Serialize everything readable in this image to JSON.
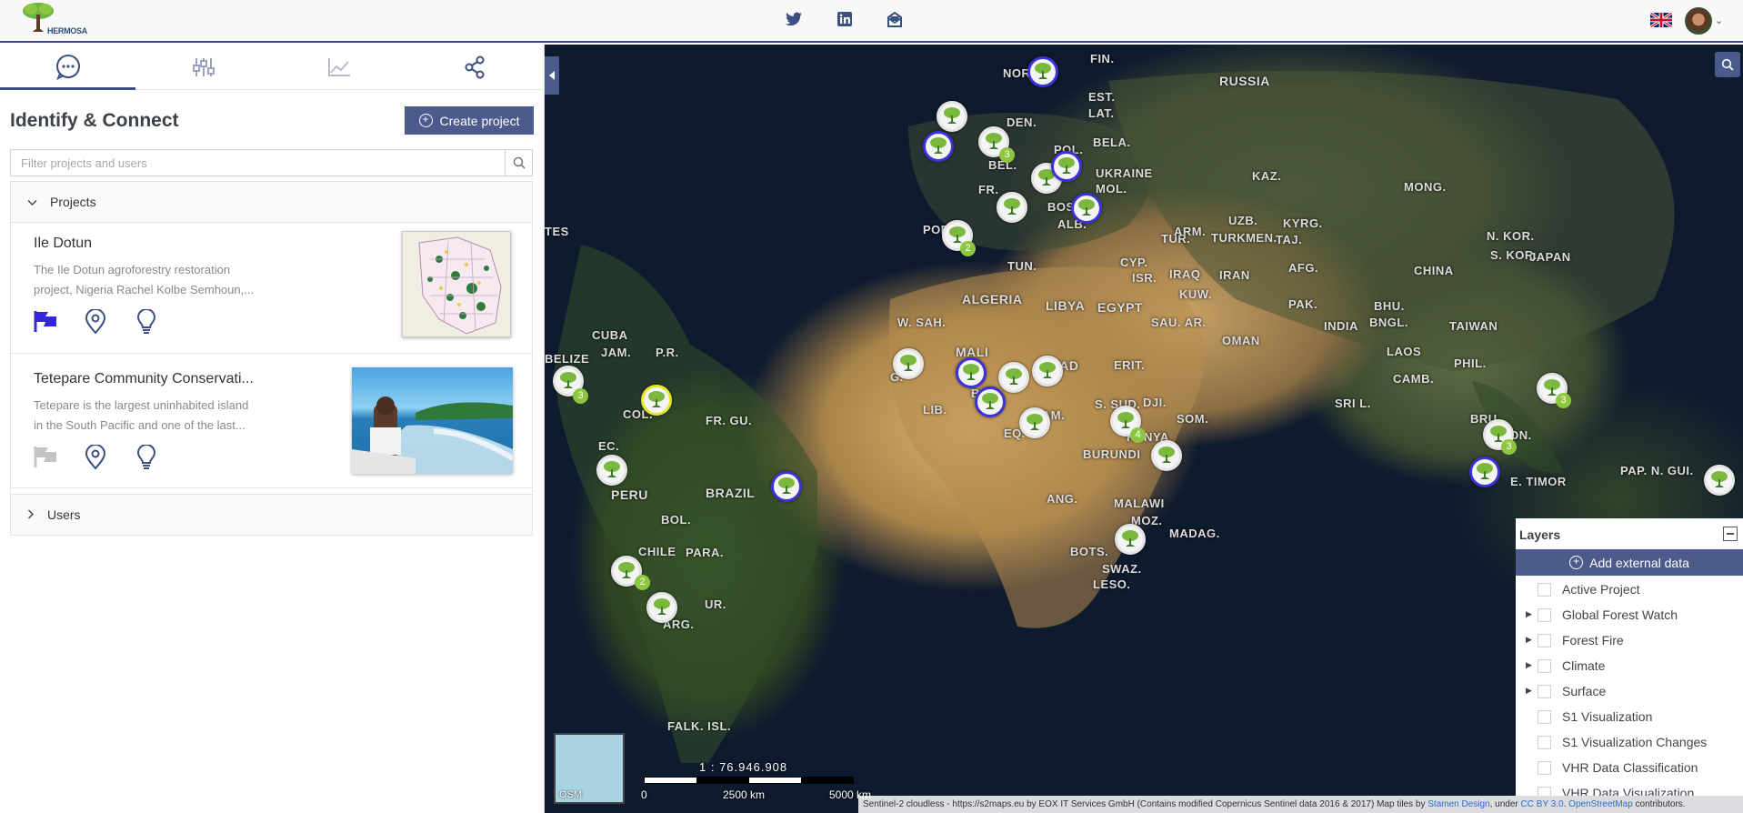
{
  "header": {
    "logo_text": "HERMOSA",
    "social": [
      "twitter-icon",
      "linkedin-icon",
      "newsletter-icon"
    ],
    "language": "en-GB flag"
  },
  "sidebar": {
    "tabs": [
      "chat-bubble-icon",
      "sliders-icon",
      "line-chart-icon",
      "share-icon"
    ],
    "active_tab": 0,
    "title": "Identify & Connect",
    "create_label": "Create project",
    "search_placeholder": "Filter projects and users",
    "projects_header": "Projects",
    "users_header": "Users",
    "projects": [
      {
        "title": "Ile Dotun",
        "desc_line1": "The Ile Dotun agroforestry restoration",
        "desc_line2": "project, Nigeria Rachel Kolbe Semhoun,...",
        "flag_active": true
      },
      {
        "title": "Tetepare Community Conservati...",
        "desc_line1": "Tetepare is the largest uninhabited island",
        "desc_line2": "in the South Pacific and one of the last...",
        "flag_active": false
      }
    ]
  },
  "map": {
    "labels": [
      "FIN.",
      "RUSSIA",
      "NOR.",
      "EST.",
      "LAT.",
      "DEN.",
      "BELA.",
      "POL.",
      "UKRAINE",
      "MOL.",
      "BEL.",
      "FR.",
      "KAZ.",
      "MONG.",
      "BOS.",
      "ALB.",
      "POR.",
      "TUR.",
      "ARM.",
      "UZB.",
      "TURKMEN.",
      "KYRG.",
      "TAJ.",
      "N. KOR.",
      "S. KOR.",
      "JAPAN",
      "TUN.",
      "CYP.",
      "ISR.",
      "IRAQ",
      "IRAN",
      "AFG.",
      "CHINA",
      "KUW.",
      "PAK.",
      "ALGERIA",
      "LIBYA",
      "EGYPT",
      "SAU. AR.",
      "OMAN",
      "BHU.",
      "BNGL.",
      "TAIWAN",
      "W. SAH.",
      "INDIA",
      "MALI",
      "CHAD",
      "ERIT.",
      "LAOS",
      "PHIL.",
      "CAMB.",
      "G.",
      "B.",
      "LIB.",
      "CAM.",
      "EQ.",
      "S. SUD.",
      "DJI.",
      "SOM.",
      "SRI L.",
      "BRU.",
      "ION.",
      "E. TIMOR",
      "PAP. N. GUI.",
      "KENYA",
      "BURUNDI",
      "ANG.",
      "MALAWI",
      "MOZ.",
      "MADAG.",
      "BOTS.",
      "SWAZ.",
      "LESO.",
      "BELIZE",
      "JAM.",
      "CUBA",
      "P.R.",
      "TES",
      "COL.",
      "FR. GU.",
      "EC.",
      "PERU",
      "BRAZIL",
      "BOL.",
      "CHILE",
      "PARA.",
      "UR.",
      "ARG.",
      "FALK. ISL."
    ],
    "scale_ratio": "1 : 76.946.908",
    "scale_labels": [
      "0",
      "2500 km",
      "5000 km"
    ],
    "basemap_label": "OSM",
    "attribution_text": "Sentinel-2 cloudless - https://s2maps.eu by EOX IT Services GmbH (Contains modified Copernicus Sentinel data 2016 & 2017) Map tiles by ",
    "attribution_link1": "Stamen Design",
    "attribution_mid": ", under ",
    "attribution_link2": "CC BY 3.0",
    "attribution_mid2": ". ",
    "attribution_link3": "OpenStreetMap",
    "attribution_end": " contributors.",
    "cluster_counts": [
      "3",
      "2",
      "4",
      "3",
      "3",
      "3",
      "2"
    ]
  },
  "layers": {
    "title": "Layers",
    "add_label": "Add external data",
    "items": [
      {
        "label": "Active Project",
        "expandable": false
      },
      {
        "label": "Global Forest Watch",
        "expandable": true
      },
      {
        "label": "Forest Fire",
        "expandable": true
      },
      {
        "label": "Climate",
        "expandable": true
      },
      {
        "label": "Surface",
        "expandable": true
      },
      {
        "label": "S1 Visualization",
        "expandable": false
      },
      {
        "label": "S1 Visualization Changes",
        "expandable": false
      },
      {
        "label": "VHR Data Classification",
        "expandable": false
      },
      {
        "label": "VHR Data Visualization",
        "expandable": false
      }
    ]
  },
  "colors": {
    "accent": "#4c5a8c",
    "marker_green": "#8dc63f",
    "marker_blue_ring": "#3b33d6",
    "marker_yellow_ring": "#e3e82b"
  }
}
